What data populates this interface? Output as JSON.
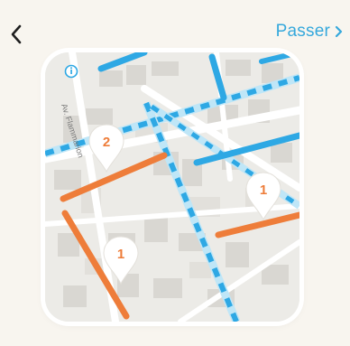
{
  "header": {
    "skip_label": "Passer"
  },
  "map": {
    "street_label": "Av. Flammarion",
    "markers": [
      {
        "number": "2"
      },
      {
        "number": "1"
      },
      {
        "number": "1"
      }
    ],
    "colors": {
      "marked_route": "#ee7d3a",
      "cycle_lane": "#2ea8e4",
      "shared_lane": "#bfe6f7",
      "land": "#ecebe7",
      "building": "#d9d7d2",
      "road": "#ffffff",
      "accent": "#35a8dc"
    }
  },
  "icons": {
    "back": "chevron-left-icon",
    "skip": "chevron-right-icon",
    "info": "info-icon",
    "marker": "map-pin-icon"
  }
}
